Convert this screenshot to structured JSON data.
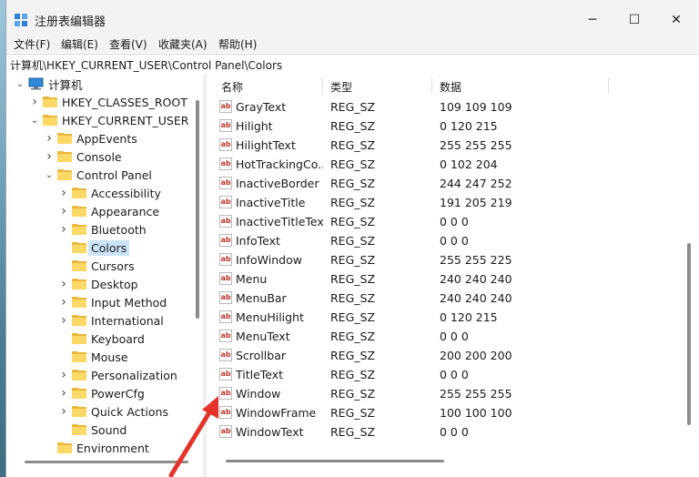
{
  "window": {
    "title": "注册表编辑器",
    "controls": {
      "minimize": "─",
      "maximize": "☐",
      "close": "✕"
    }
  },
  "menu": [
    "文件(F)",
    "编辑(E)",
    "查看(V)",
    "收藏夹(A)",
    "帮助(H)"
  ],
  "address": "计算机\\HKEY_CURRENT_USER\\Control Panel\\Colors",
  "tree": {
    "root": "计算机",
    "items": [
      {
        "label": "HKEY_CLASSES_ROOT",
        "level": 1,
        "expanded": false
      },
      {
        "label": "HKEY_CURRENT_USER",
        "level": 1,
        "expanded": true
      },
      {
        "label": "AppEvents",
        "level": 2,
        "expanded": false
      },
      {
        "label": "Console",
        "level": 2,
        "expanded": false
      },
      {
        "label": "Control Panel",
        "level": 2,
        "expanded": true
      },
      {
        "label": "Accessibility",
        "level": 3,
        "expanded": false
      },
      {
        "label": "Appearance",
        "level": 3,
        "expanded": false
      },
      {
        "label": "Bluetooth",
        "level": 3,
        "expanded": false
      },
      {
        "label": "Colors",
        "level": 3,
        "expanded": false,
        "selected": true,
        "leaf": true
      },
      {
        "label": "Cursors",
        "level": 3,
        "leaf": true
      },
      {
        "label": "Desktop",
        "level": 3,
        "expanded": false
      },
      {
        "label": "Input Method",
        "level": 3,
        "expanded": false
      },
      {
        "label": "International",
        "level": 3,
        "expanded": false
      },
      {
        "label": "Keyboard",
        "level": 3,
        "leaf": true
      },
      {
        "label": "Mouse",
        "level": 3,
        "leaf": true
      },
      {
        "label": "Personalization",
        "level": 3,
        "expanded": false
      },
      {
        "label": "PowerCfg",
        "level": 3,
        "expanded": false
      },
      {
        "label": "Quick Actions",
        "level": 3,
        "expanded": false
      },
      {
        "label": "Sound",
        "level": 3,
        "leaf": true
      },
      {
        "label": "Environment",
        "level": 2,
        "leaf": true
      }
    ]
  },
  "list": {
    "columns": {
      "name": "名称",
      "type": "类型",
      "data": "数据"
    },
    "rows": [
      {
        "name": "GrayText",
        "type": "REG_SZ",
        "data": "109 109 109"
      },
      {
        "name": "Hilight",
        "type": "REG_SZ",
        "data": "0 120 215"
      },
      {
        "name": "HilightText",
        "type": "REG_SZ",
        "data": "255 255 255"
      },
      {
        "name": "HotTrackingCo...",
        "type": "REG_SZ",
        "data": "0 102 204"
      },
      {
        "name": "InactiveBorder",
        "type": "REG_SZ",
        "data": "244 247 252"
      },
      {
        "name": "InactiveTitle",
        "type": "REG_SZ",
        "data": "191 205 219"
      },
      {
        "name": "InactiveTitleText",
        "type": "REG_SZ",
        "data": "0 0 0"
      },
      {
        "name": "InfoText",
        "type": "REG_SZ",
        "data": "0 0 0"
      },
      {
        "name": "InfoWindow",
        "type": "REG_SZ",
        "data": "255 255 225"
      },
      {
        "name": "Menu",
        "type": "REG_SZ",
        "data": "240 240 240"
      },
      {
        "name": "MenuBar",
        "type": "REG_SZ",
        "data": "240 240 240"
      },
      {
        "name": "MenuHilight",
        "type": "REG_SZ",
        "data": "0 120 215"
      },
      {
        "name": "MenuText",
        "type": "REG_SZ",
        "data": "0 0 0"
      },
      {
        "name": "Scrollbar",
        "type": "REG_SZ",
        "data": "200 200 200"
      },
      {
        "name": "TitleText",
        "type": "REG_SZ",
        "data": "0 0 0"
      },
      {
        "name": "Window",
        "type": "REG_SZ",
        "data": "255 255 255"
      },
      {
        "name": "WindowFrame",
        "type": "REG_SZ",
        "data": "100 100 100"
      },
      {
        "name": "WindowText",
        "type": "REG_SZ",
        "data": "0 0 0"
      }
    ]
  },
  "icons": {
    "string_value": "ab",
    "app": "registry-editor-icon",
    "computer": "computer-icon",
    "folder": "folder-icon"
  },
  "colors": {
    "selection": "#cce4f7",
    "folder": "#fcd866",
    "annotation_arrow": "#e5332a"
  }
}
